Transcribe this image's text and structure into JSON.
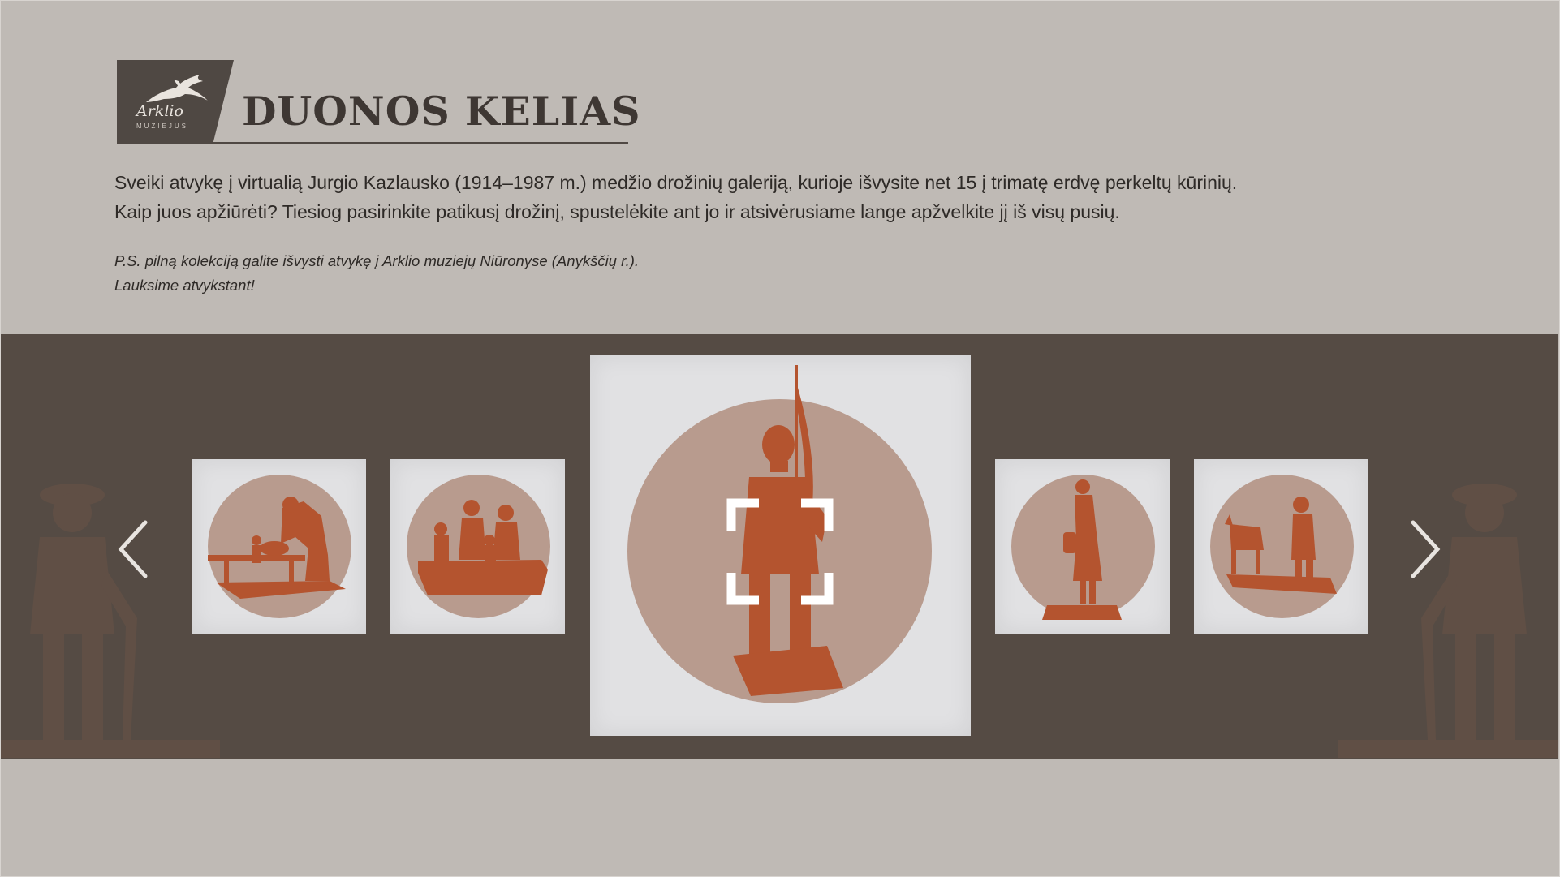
{
  "header": {
    "logo_word": "Arklio",
    "logo_sub": "MUZIEJUS",
    "title": "DUONOS KELIAS"
  },
  "intro": {
    "line1": "Sveiki atvykę į virtualią Jurgio Kazlausko (1914–1987 m.) medžio drožinių galeriją, kurioje išvysite net 15 į trimatę erdvę perkeltų kūrinių.",
    "line2": "Kaip juos apžiūrėti? Tiesiog pasirinkite patikusį drožinį, spustelėkite ant jo ir atsivėrusiame lange apžvelkite jį iš visų pusių."
  },
  "ps": {
    "line1": "P.S. pilną kolekciją galite išvysti atvykę į Arklio muziejų Niūronyse (Anykščių r.).",
    "line2": "Lauksime atvykstant!"
  },
  "gallery": {
    "prev_icon": "chevron-left-icon",
    "next_icon": "chevron-right-icon",
    "expand_icon": "fullscreen-expand-icon",
    "items": [
      {
        "subject": "woman-kneading-dough-at-table"
      },
      {
        "subject": "family-at-table"
      },
      {
        "subject": "sower-with-staff",
        "active": true
      },
      {
        "subject": "woman-with-jug"
      },
      {
        "subject": "horse-and-plowman"
      }
    ]
  },
  "colors": {
    "page_bg": "#bfbab5",
    "band_bg": "#554b44",
    "logo_bg": "#4f4843",
    "title_text": "#3e3733",
    "disc": "#b89b8e",
    "carving": "#b4542f",
    "card_bg": "#e1e1e3"
  }
}
